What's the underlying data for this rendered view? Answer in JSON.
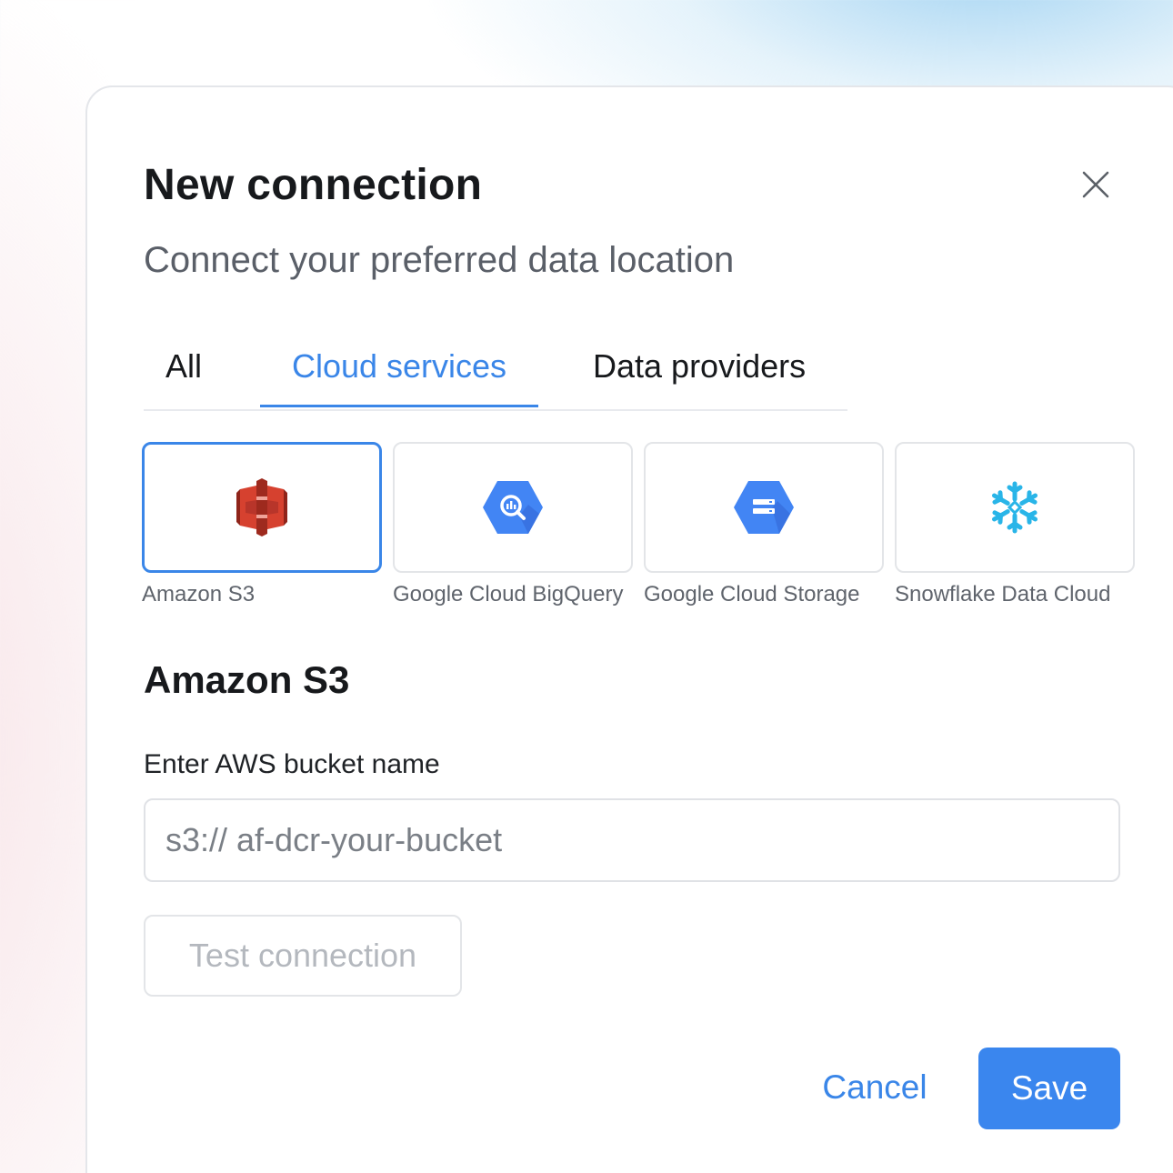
{
  "dialog": {
    "title": "New connection",
    "subtitle": "Connect your preferred data location"
  },
  "tabs": [
    {
      "label": "All",
      "active": false
    },
    {
      "label": "Cloud services",
      "active": true
    },
    {
      "label": "Data providers",
      "active": false
    }
  ],
  "services": [
    {
      "label": "Amazon S3",
      "icon": "amazon-s3-icon",
      "selected": true
    },
    {
      "label": "Google Cloud BigQuery",
      "icon": "bigquery-icon",
      "selected": false
    },
    {
      "label": "Google Cloud Storage",
      "icon": "cloud-storage-icon",
      "selected": false
    },
    {
      "label": "Snowflake Data Cloud",
      "icon": "snowflake-icon",
      "selected": false
    }
  ],
  "form": {
    "section_title": "Amazon S3",
    "field_label": "Enter AWS bucket name",
    "placeholder": "s3:// af-dcr-your-bucket",
    "value": ""
  },
  "actions": {
    "test_label": "Test connection",
    "cancel_label": "Cancel",
    "save_label": "Save"
  },
  "colors": {
    "accent": "#3a86e8",
    "s3_red": "#d6412f",
    "google_blue": "#4285f4",
    "snowflake_cyan": "#29b5e8"
  }
}
